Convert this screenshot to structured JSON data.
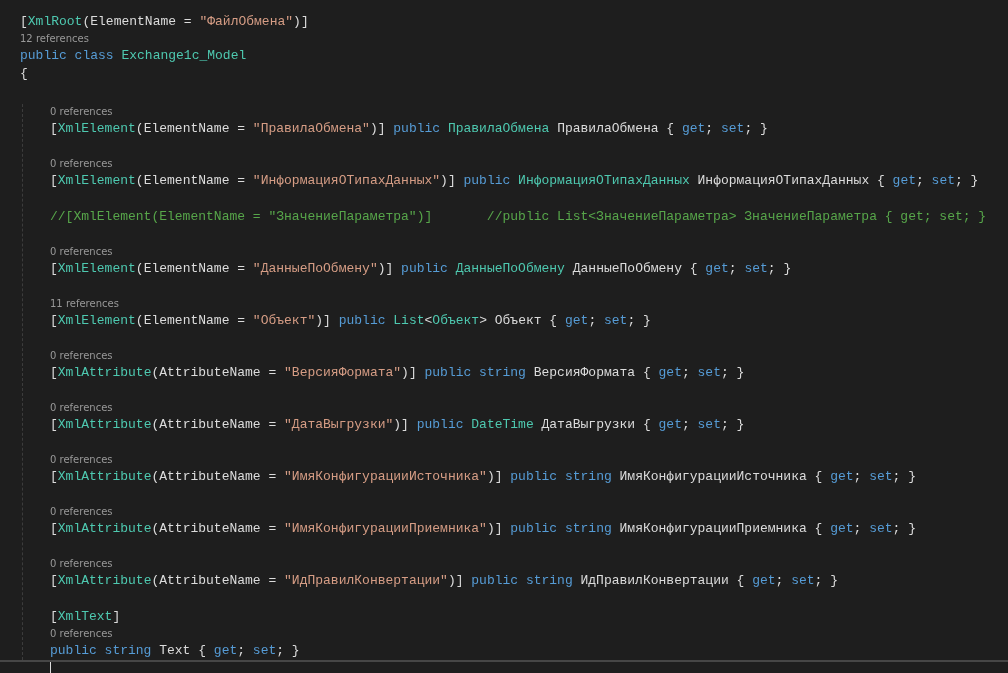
{
  "class": {
    "attribute": [
      {
        "kind": "plain",
        "text": "["
      },
      {
        "kind": "type",
        "text": "XmlRoot"
      },
      {
        "kind": "plain",
        "text": "(ElementName = "
      },
      {
        "kind": "string",
        "text": "\"ФайлОбмена\""
      },
      {
        "kind": "plain",
        "text": ")]"
      }
    ],
    "lens": "12 references",
    "declaration": [
      {
        "kind": "keyword",
        "text": "public class "
      },
      {
        "kind": "type",
        "text": "Exchange1c_Model"
      }
    ],
    "open_brace": "{",
    "members": [
      {
        "rows": [
          {
            "kind": "lens",
            "text": "0 references"
          },
          {
            "kind": "code",
            "tokens": [
              {
                "kind": "plain",
                "text": "["
              },
              {
                "kind": "type",
                "text": "XmlElement"
              },
              {
                "kind": "plain",
                "text": "(ElementName = "
              },
              {
                "kind": "string",
                "text": "\"ПравилаОбмена\""
              },
              {
                "kind": "plain",
                "text": ")] "
              },
              {
                "kind": "keyword",
                "text": "public "
              },
              {
                "kind": "type",
                "text": "ПравилаОбмена"
              },
              {
                "kind": "plain",
                "text": " ПравилаОбмена { "
              },
              {
                "kind": "keyword",
                "text": "get"
              },
              {
                "kind": "plain",
                "text": "; "
              },
              {
                "kind": "keyword",
                "text": "set"
              },
              {
                "kind": "plain",
                "text": "; }"
              }
            ]
          }
        ]
      },
      {
        "rows": [
          {
            "kind": "lens",
            "text": "0 references"
          },
          {
            "kind": "code",
            "tokens": [
              {
                "kind": "plain",
                "text": "["
              },
              {
                "kind": "type",
                "text": "XmlElement"
              },
              {
                "kind": "plain",
                "text": "(ElementName = "
              },
              {
                "kind": "string",
                "text": "\"ИнформацияОТипахДанных\""
              },
              {
                "kind": "plain",
                "text": ")] "
              },
              {
                "kind": "keyword",
                "text": "public "
              },
              {
                "kind": "type",
                "text": "ИнформацияОТипахДанных"
              },
              {
                "kind": "plain",
                "text": " ИнформацияОТипахДанных { "
              },
              {
                "kind": "keyword",
                "text": "get"
              },
              {
                "kind": "plain",
                "text": "; "
              },
              {
                "kind": "keyword",
                "text": "set"
              },
              {
                "kind": "plain",
                "text": "; }"
              }
            ]
          }
        ]
      },
      {
        "rows": [
          {
            "kind": "code",
            "tokens": [
              {
                "kind": "comment",
                "text": "//[XmlElement(ElementName = \"ЗначениеПараметра\")]       //public List<ЗначениеПараметра> ЗначениеПараметра { get; set; }"
              }
            ]
          }
        ]
      },
      {
        "rows": [
          {
            "kind": "lens",
            "text": "0 references"
          },
          {
            "kind": "code",
            "tokens": [
              {
                "kind": "plain",
                "text": "["
              },
              {
                "kind": "type",
                "text": "XmlElement"
              },
              {
                "kind": "plain",
                "text": "(ElementName = "
              },
              {
                "kind": "string",
                "text": "\"ДанныеПоОбмену\""
              },
              {
                "kind": "plain",
                "text": ")] "
              },
              {
                "kind": "keyword",
                "text": "public "
              },
              {
                "kind": "type",
                "text": "ДанныеПоОбмену"
              },
              {
                "kind": "plain",
                "text": " ДанныеПоОбмену { "
              },
              {
                "kind": "keyword",
                "text": "get"
              },
              {
                "kind": "plain",
                "text": "; "
              },
              {
                "kind": "keyword",
                "text": "set"
              },
              {
                "kind": "plain",
                "text": "; }"
              }
            ]
          }
        ]
      },
      {
        "rows": [
          {
            "kind": "lens",
            "text": "11 references"
          },
          {
            "kind": "code",
            "tokens": [
              {
                "kind": "plain",
                "text": "["
              },
              {
                "kind": "type",
                "text": "XmlElement"
              },
              {
                "kind": "plain",
                "text": "(ElementName = "
              },
              {
                "kind": "string",
                "text": "\"Объект\""
              },
              {
                "kind": "plain",
                "text": ")] "
              },
              {
                "kind": "keyword",
                "text": "public "
              },
              {
                "kind": "type",
                "text": "List"
              },
              {
                "kind": "plain",
                "text": "<"
              },
              {
                "kind": "type",
                "text": "Объект"
              },
              {
                "kind": "plain",
                "text": "> Объект { "
              },
              {
                "kind": "keyword",
                "text": "get"
              },
              {
                "kind": "plain",
                "text": "; "
              },
              {
                "kind": "keyword",
                "text": "set"
              },
              {
                "kind": "plain",
                "text": "; }"
              }
            ]
          }
        ]
      },
      {
        "rows": [
          {
            "kind": "lens",
            "text": "0 references"
          },
          {
            "kind": "code",
            "tokens": [
              {
                "kind": "plain",
                "text": "["
              },
              {
                "kind": "type",
                "text": "XmlAttribute"
              },
              {
                "kind": "plain",
                "text": "(AttributeName = "
              },
              {
                "kind": "string",
                "text": "\"ВерсияФормата\""
              },
              {
                "kind": "plain",
                "text": ")] "
              },
              {
                "kind": "keyword",
                "text": "public string "
              },
              {
                "kind": "plain",
                "text": "ВерсияФормата { "
              },
              {
                "kind": "keyword",
                "text": "get"
              },
              {
                "kind": "plain",
                "text": "; "
              },
              {
                "kind": "keyword",
                "text": "set"
              },
              {
                "kind": "plain",
                "text": "; }"
              }
            ]
          }
        ]
      },
      {
        "rows": [
          {
            "kind": "lens",
            "text": "0 references"
          },
          {
            "kind": "code",
            "tokens": [
              {
                "kind": "plain",
                "text": "["
              },
              {
                "kind": "type",
                "text": "XmlAttribute"
              },
              {
                "kind": "plain",
                "text": "(AttributeName = "
              },
              {
                "kind": "string",
                "text": "\"ДатаВыгрузки\""
              },
              {
                "kind": "plain",
                "text": ")] "
              },
              {
                "kind": "keyword",
                "text": "public "
              },
              {
                "kind": "type",
                "text": "DateTime"
              },
              {
                "kind": "plain",
                "text": " ДатаВыгрузки { "
              },
              {
                "kind": "keyword",
                "text": "get"
              },
              {
                "kind": "plain",
                "text": "; "
              },
              {
                "kind": "keyword",
                "text": "set"
              },
              {
                "kind": "plain",
                "text": "; }"
              }
            ]
          }
        ]
      },
      {
        "rows": [
          {
            "kind": "lens",
            "text": "0 references"
          },
          {
            "kind": "code",
            "tokens": [
              {
                "kind": "plain",
                "text": "["
              },
              {
                "kind": "type",
                "text": "XmlAttribute"
              },
              {
                "kind": "plain",
                "text": "(AttributeName = "
              },
              {
                "kind": "string",
                "text": "\"ИмяКонфигурацииИсточника\""
              },
              {
                "kind": "plain",
                "text": ")] "
              },
              {
                "kind": "keyword",
                "text": "public string "
              },
              {
                "kind": "plain",
                "text": "ИмяКонфигурацииИсточника { "
              },
              {
                "kind": "keyword",
                "text": "get"
              },
              {
                "kind": "plain",
                "text": "; "
              },
              {
                "kind": "keyword",
                "text": "set"
              },
              {
                "kind": "plain",
                "text": "; }"
              }
            ]
          }
        ]
      },
      {
        "rows": [
          {
            "kind": "lens",
            "text": "0 references"
          },
          {
            "kind": "code",
            "tokens": [
              {
                "kind": "plain",
                "text": "["
              },
              {
                "kind": "type",
                "text": "XmlAttribute"
              },
              {
                "kind": "plain",
                "text": "(AttributeName = "
              },
              {
                "kind": "string",
                "text": "\"ИмяКонфигурацииПриемника\""
              },
              {
                "kind": "plain",
                "text": ")] "
              },
              {
                "kind": "keyword",
                "text": "public string "
              },
              {
                "kind": "plain",
                "text": "ИмяКонфигурацииПриемника { "
              },
              {
                "kind": "keyword",
                "text": "get"
              },
              {
                "kind": "plain",
                "text": "; "
              },
              {
                "kind": "keyword",
                "text": "set"
              },
              {
                "kind": "plain",
                "text": "; }"
              }
            ]
          }
        ]
      },
      {
        "rows": [
          {
            "kind": "lens",
            "text": "0 references"
          },
          {
            "kind": "code",
            "tokens": [
              {
                "kind": "plain",
                "text": "["
              },
              {
                "kind": "type",
                "text": "XmlAttribute"
              },
              {
                "kind": "plain",
                "text": "(AttributeName = "
              },
              {
                "kind": "string",
                "text": "\"ИдПравилКонвертации\""
              },
              {
                "kind": "plain",
                "text": ")] "
              },
              {
                "kind": "keyword",
                "text": "public string "
              },
              {
                "kind": "plain",
                "text": "ИдПравилКонвертации { "
              },
              {
                "kind": "keyword",
                "text": "get"
              },
              {
                "kind": "plain",
                "text": "; "
              },
              {
                "kind": "keyword",
                "text": "set"
              },
              {
                "kind": "plain",
                "text": "; }"
              }
            ]
          }
        ]
      },
      {
        "rows": [
          {
            "kind": "code",
            "tokens": [
              {
                "kind": "plain",
                "text": "["
              },
              {
                "kind": "type",
                "text": "XmlText"
              },
              {
                "kind": "plain",
                "text": "]"
              }
            ]
          },
          {
            "kind": "lens",
            "text": "0 references"
          },
          {
            "kind": "code",
            "tokens": [
              {
                "kind": "keyword",
                "text": "public string "
              },
              {
                "kind": "plain",
                "text": "Text { "
              },
              {
                "kind": "keyword",
                "text": "get"
              },
              {
                "kind": "plain",
                "text": "; "
              },
              {
                "kind": "keyword",
                "text": "set"
              },
              {
                "kind": "plain",
                "text": "; }"
              }
            ]
          }
        ]
      }
    ]
  }
}
